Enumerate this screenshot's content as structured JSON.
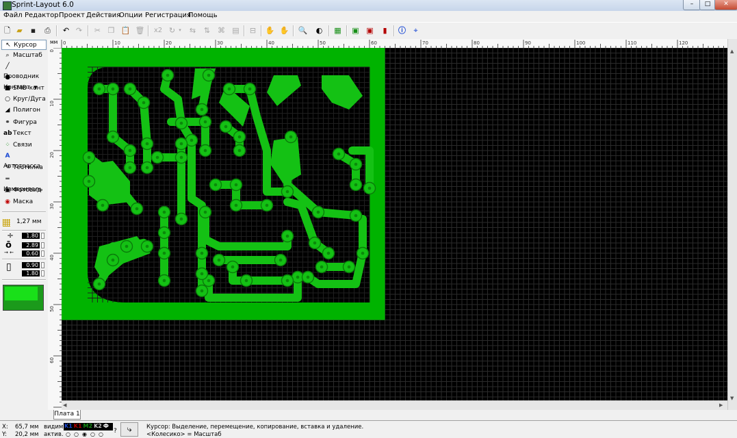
{
  "window": {
    "title": "Sprint-Layout 6.0"
  },
  "menu": [
    "Файл",
    "Редактор",
    "Проект",
    "Действия",
    "Опции",
    "Регистрация",
    "Помощь"
  ],
  "toolbar": {
    "x2_label": "x2"
  },
  "tools": [
    {
      "label": "Курсор",
      "icon": "cursor-icon",
      "glyph": "↖",
      "active": true
    },
    {
      "label": "Масштаб",
      "icon": "zoom-icon",
      "glyph": "⌕",
      "active": false
    },
    {
      "label": "Проводник",
      "icon": "track-icon",
      "glyph": "╱",
      "active": false
    },
    {
      "label": "Контакт",
      "icon": "pad-icon",
      "glyph": "●",
      "active": false
    },
    {
      "label": "SMD-конт",
      "icon": "smd-pad-icon",
      "glyph": "■",
      "active": false
    },
    {
      "label": "Круг/Дуга",
      "icon": "circle-icon",
      "glyph": "○",
      "active": false
    },
    {
      "label": "Полигон",
      "icon": "polygon-icon",
      "glyph": "◢",
      "active": false
    },
    {
      "label": "Фигура",
      "icon": "shape-icon",
      "glyph": "⚭",
      "active": false
    },
    {
      "label": "Текст",
      "icon": "text-icon",
      "glyph": "ab",
      "active": false
    },
    {
      "label": "Связи",
      "icon": "connections-icon",
      "glyph": "⁘",
      "active": false
    },
    {
      "label": "Автотрасса",
      "icon": "autoroute-icon",
      "glyph": "A",
      "active": false
    },
    {
      "label": "Тестилка",
      "icon": "tester-icon",
      "glyph": "✎",
      "active": false
    },
    {
      "label": "Измеритель",
      "icon": "measure-icon",
      "glyph": "═",
      "active": false
    },
    {
      "label": "Фотовид",
      "icon": "photoview-icon",
      "glyph": "▣",
      "active": false
    },
    {
      "label": "Маска",
      "icon": "mask-icon",
      "glyph": "◉",
      "active": false
    }
  ],
  "grid": {
    "value": "1,27 мм"
  },
  "params": {
    "track_width": "1.80",
    "pad_outer": "2.89",
    "pad_inner": "0.60",
    "smd_w": "0.90",
    "smd_h": "1.80"
  },
  "ruler": {
    "unit": "мм",
    "top_labels": [
      "0",
      "10",
      "20",
      "30",
      "40",
      "50",
      "60",
      "70",
      "80",
      "90",
      "100",
      "110",
      "120"
    ],
    "left_labels": [
      "0",
      "10",
      "20",
      "30",
      "40",
      "50",
      "60"
    ]
  },
  "colors": {
    "board": "#00b300",
    "canvas": "#000000",
    "grid": "#2b2b2b",
    "cu": "#14c114",
    "cu_outline": "#0a7a0a"
  },
  "board": {
    "width_mm": 63,
    "height_mm": 53
  },
  "tab": {
    "label": "Плата 1"
  },
  "status": {
    "x_label": "X:",
    "x_value": "65,7 мм",
    "y_label": "Y:",
    "y_value": "20,2 мм",
    "visible_label": "видим.",
    "active_label": "актив.",
    "layers": [
      {
        "label": "K1",
        "color": "#1a49d4"
      },
      {
        "label": "K1",
        "color": "#b40000"
      },
      {
        "label": "M2",
        "color": "#158e15"
      },
      {
        "label": "K2",
        "color": "#cccccc"
      },
      {
        "label": "Ф",
        "color": "#ffffff"
      }
    ],
    "help_line1": "Курсор: Выделение, перемещение, копирование, вставка и удаление.",
    "help_line2": "<Колесико> = Масштаб"
  }
}
